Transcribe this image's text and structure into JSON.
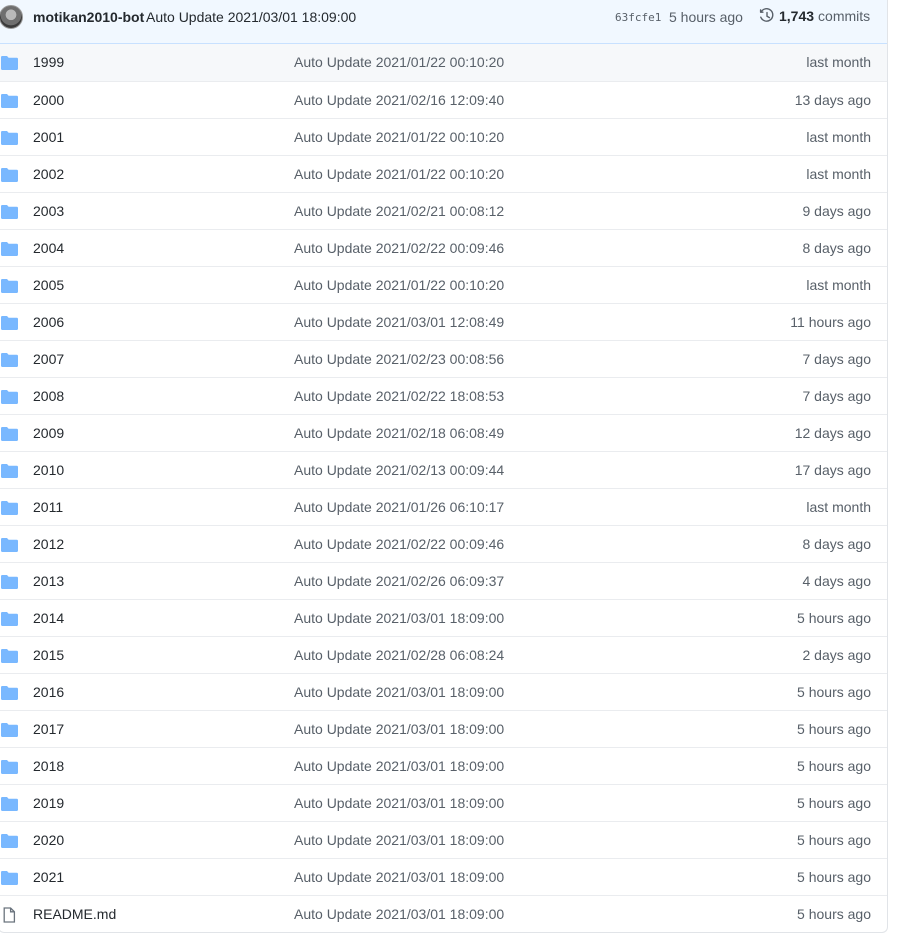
{
  "commit": {
    "author": "motikan2010-bot",
    "message": "Auto Update 2021/03/01 18:09:00",
    "sha": "63fcfe1",
    "time": "5 hours ago",
    "commit_count": "1,743",
    "commits_label": "commits"
  },
  "rows": [
    {
      "name": "1999",
      "type": "folder",
      "message": "Auto Update 2021/01/22 00:10:20",
      "age": "last month"
    },
    {
      "name": "2000",
      "type": "folder",
      "message": "Auto Update 2021/02/16 12:09:40",
      "age": "13 days ago"
    },
    {
      "name": "2001",
      "type": "folder",
      "message": "Auto Update 2021/01/22 00:10:20",
      "age": "last month"
    },
    {
      "name": "2002",
      "type": "folder",
      "message": "Auto Update 2021/01/22 00:10:20",
      "age": "last month"
    },
    {
      "name": "2003",
      "type": "folder",
      "message": "Auto Update 2021/02/21 00:08:12",
      "age": "9 days ago"
    },
    {
      "name": "2004",
      "type": "folder",
      "message": "Auto Update 2021/02/22 00:09:46",
      "age": "8 days ago"
    },
    {
      "name": "2005",
      "type": "folder",
      "message": "Auto Update 2021/01/22 00:10:20",
      "age": "last month"
    },
    {
      "name": "2006",
      "type": "folder",
      "message": "Auto Update 2021/03/01 12:08:49",
      "age": "11 hours ago"
    },
    {
      "name": "2007",
      "type": "folder",
      "message": "Auto Update 2021/02/23 00:08:56",
      "age": "7 days ago"
    },
    {
      "name": "2008",
      "type": "folder",
      "message": "Auto Update 2021/02/22 18:08:53",
      "age": "7 days ago"
    },
    {
      "name": "2009",
      "type": "folder",
      "message": "Auto Update 2021/02/18 06:08:49",
      "age": "12 days ago"
    },
    {
      "name": "2010",
      "type": "folder",
      "message": "Auto Update 2021/02/13 00:09:44",
      "age": "17 days ago"
    },
    {
      "name": "2011",
      "type": "folder",
      "message": "Auto Update 2021/01/26 06:10:17",
      "age": "last month"
    },
    {
      "name": "2012",
      "type": "folder",
      "message": "Auto Update 2021/02/22 00:09:46",
      "age": "8 days ago"
    },
    {
      "name": "2013",
      "type": "folder",
      "message": "Auto Update 2021/02/26 06:09:37",
      "age": "4 days ago"
    },
    {
      "name": "2014",
      "type": "folder",
      "message": "Auto Update 2021/03/01 18:09:00",
      "age": "5 hours ago"
    },
    {
      "name": "2015",
      "type": "folder",
      "message": "Auto Update 2021/02/28 06:08:24",
      "age": "2 days ago"
    },
    {
      "name": "2016",
      "type": "folder",
      "message": "Auto Update 2021/03/01 18:09:00",
      "age": "5 hours ago"
    },
    {
      "name": "2017",
      "type": "folder",
      "message": "Auto Update 2021/03/01 18:09:00",
      "age": "5 hours ago"
    },
    {
      "name": "2018",
      "type": "folder",
      "message": "Auto Update 2021/03/01 18:09:00",
      "age": "5 hours ago"
    },
    {
      "name": "2019",
      "type": "folder",
      "message": "Auto Update 2021/03/01 18:09:00",
      "age": "5 hours ago"
    },
    {
      "name": "2020",
      "type": "folder",
      "message": "Auto Update 2021/03/01 18:09:00",
      "age": "5 hours ago"
    },
    {
      "name": "2021",
      "type": "folder",
      "message": "Auto Update 2021/03/01 18:09:00",
      "age": "5 hours ago"
    },
    {
      "name": "README.md",
      "type": "file",
      "message": "Auto Update 2021/03/01 18:09:00",
      "age": "5 hours ago"
    }
  ]
}
